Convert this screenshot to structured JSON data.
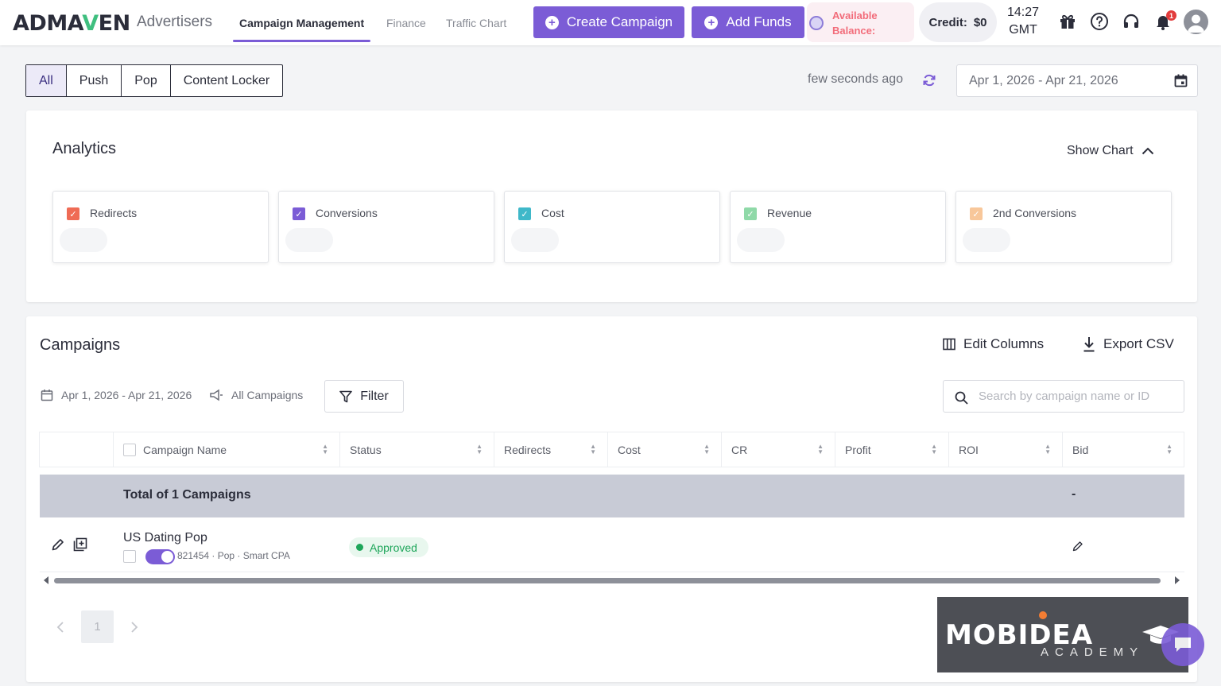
{
  "header": {
    "logo_left": "AD",
    "logo_mid": "MA",
    "logo_v": "V",
    "logo_right": "EN",
    "logo_sub": "Advertisers",
    "nav": [
      {
        "label": "Campaign Management",
        "active": true
      },
      {
        "label": "Finance",
        "active": false
      },
      {
        "label": "Traffic Chart",
        "active": false
      }
    ],
    "create_campaign": "Create Campaign",
    "add_funds": "Add Funds",
    "balance_line1": "Available",
    "balance_line2": "Balance:",
    "credit_label": "Credit:",
    "credit_value": "$0",
    "time": "14:27",
    "timezone": "GMT",
    "notification_count": "1",
    "icons": [
      "gift-icon",
      "help-icon",
      "headset-icon",
      "bell-icon",
      "user-icon"
    ]
  },
  "filters": {
    "types": [
      "All",
      "Push",
      "Pop",
      "Content Locker"
    ],
    "selected_type": "All",
    "updated": "few seconds ago",
    "date_range": "Apr 1, 2026 - Apr 21, 2026"
  },
  "analytics": {
    "title": "Analytics",
    "show_chart": "Show Chart",
    "metrics": [
      {
        "label": "Redirects",
        "color": "#ef6b55"
      },
      {
        "label": "Conversions",
        "color": "#7b5cd6"
      },
      {
        "label": "Cost",
        "color": "#3fb8c9"
      },
      {
        "label": "Revenue",
        "color": "#8fd9a8"
      },
      {
        "label": "2nd Conversions",
        "color": "#f8c79a"
      }
    ]
  },
  "campaigns": {
    "title": "Campaigns",
    "edit_columns": "Edit Columns",
    "export_csv": "Export CSV",
    "date_range": "Apr 1, 2026 - Apr 21, 2026",
    "scope": "All Campaigns",
    "filter": "Filter",
    "search_placeholder": "Search by campaign name or ID",
    "columns": [
      "Campaign Name",
      "Status",
      "Redirects",
      "Cost",
      "CR",
      "Profit",
      "ROI",
      "Bid"
    ],
    "total_label": "Total of 1 Campaigns",
    "total_bid": "-",
    "rows": [
      {
        "name": "US Dating Pop",
        "meta": "821454 · Pop · Smart CPA",
        "status": "Approved",
        "active": true
      }
    ],
    "pagination": {
      "current_page": "1"
    }
  },
  "promo": {
    "main": "MOBIDEA",
    "sub": "ACADEMY"
  },
  "colors": {
    "accent": "#7b5cd6",
    "approved": "#1ea65a",
    "balance_text": "#f26c7a"
  }
}
